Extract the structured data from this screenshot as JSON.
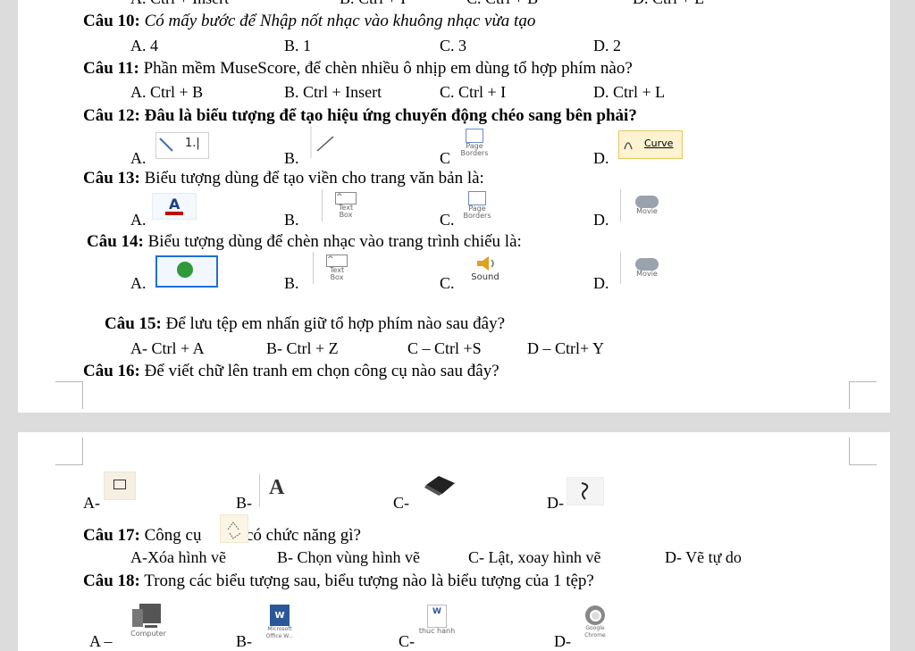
{
  "top_cut": {
    "a": "A. Ctrl + Insert",
    "b": "B. Ctrl + I",
    "c": "C. Ctrl + B",
    "d": "D. Ctrl + L"
  },
  "q10": {
    "label": "Câu 10:",
    "text": "Có mấy bước để Nhập nốt nhạc vào khuông nhạc vừa tạo",
    "a": "A. 4",
    "b": "B. 1",
    "c": "C. 3",
    "d": "D. 2"
  },
  "q11": {
    "label": "Câu 11:",
    "text": "Phần mềm MuseScore, để chèn nhiều ô nhịp em dùng tổ hợp phím nào?",
    "a": "A. Ctrl + B",
    "b": "B. Ctrl + Insert",
    "c": "C. Ctrl + I",
    "d": "D. Ctrl + L"
  },
  "q12": {
    "label": "Câu 12:",
    "text": "Đâu là biểu tượng để tạo hiệu ứng chuyển động chéo sang bên phải?",
    "a": "A.",
    "b": "B.",
    "c": "C",
    "d": "D.",
    "icon_a_text": "1.|",
    "icon_c_text1": "Page",
    "icon_c_text2": "Borders",
    "icon_d_text": "Curve"
  },
  "q13": {
    "label": "Câu 13:",
    "text": "Biểu tượng dùng để tạo viền cho trang văn bản là:",
    "a": "A.",
    "b": "B.",
    "c": "C.",
    "d": "D.",
    "icon_a_text": "A",
    "icon_b_text1": "Text",
    "icon_b_text2": "Box",
    "icon_c_text1": "Page",
    "icon_c_text2": "Borders",
    "icon_d_text": "Movie"
  },
  "q14": {
    "label": "Câu 14:",
    "text": "Biểu tượng dùng để chèn nhạc vào trang trình chiếu là:",
    "a": "A.",
    "b": "B.",
    "c": "C.",
    "d": "D.",
    "icon_b_text1": "Text",
    "icon_b_text2": "Box",
    "icon_c_text": "Sound",
    "icon_d_text": "Movie"
  },
  "q15": {
    "label": "Câu 15:",
    "text": "Để lưu tệp em nhấn giữ tổ hợp phím nào sau đây?",
    "a": "A- Ctrl + A",
    "b": "B- Ctrl + Z",
    "c": "C – Ctrl +S",
    "d": "D – Ctrl+ Y"
  },
  "q16": {
    "label": "Câu 16:",
    "text": "Để viết chữ lên tranh em chọn công cụ nào sau đây?",
    "a": "A-",
    "b": "B-",
    "c": "C-",
    "d": "D-",
    "icon_b_text": "A"
  },
  "q17": {
    "label": "Câu 17:",
    "text_before": "Công cụ",
    "text_after": "có chức năng gì?",
    "a": "A-Xóa hình vẽ",
    "b": "B- Chọn vùng hình vẽ",
    "c": "C- Lật, xoay hình vẽ",
    "d": "D- Vẽ tự do"
  },
  "q18": {
    "label": "Câu 18:",
    "text": "Trong các biểu tượng sau, biểu tượng nào là biểu tượng của 1 tệp?",
    "a": "A –",
    "b": "B-",
    "c": "C-",
    "d": "D-",
    "icon_a_caption": "Computer",
    "icon_b_caption": "Microsoft Office W...",
    "icon_c_caption": "thuc hanh",
    "icon_d_caption": "Google Chrome"
  },
  "colors": {
    "accent_red": "#c00000",
    "selection_blue": "#1e6fd6",
    "icon_green": "#2e9a3a",
    "word_blue": "#2b579a"
  }
}
